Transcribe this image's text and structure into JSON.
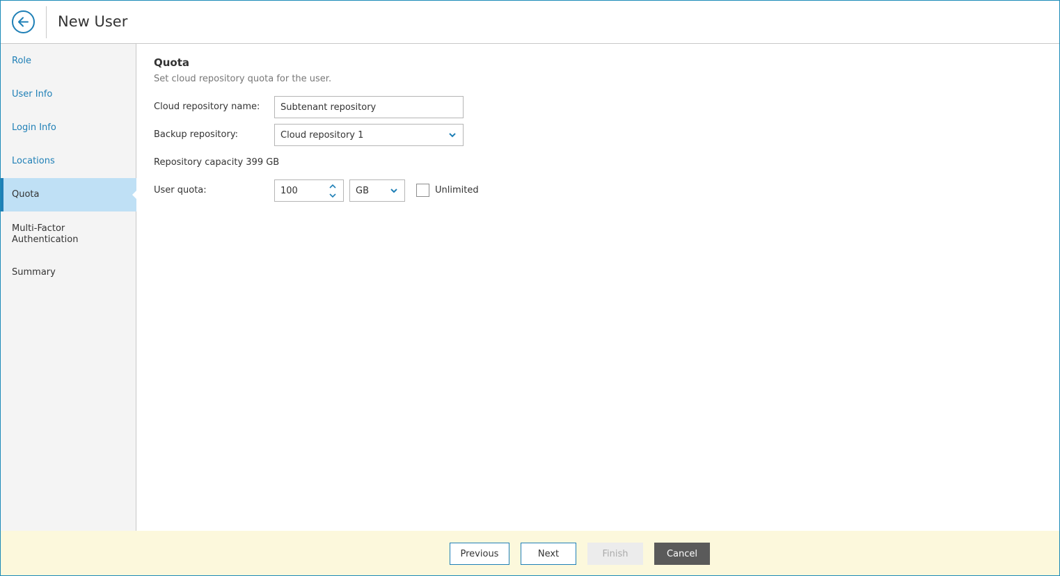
{
  "header": {
    "title": "New User"
  },
  "sidebar": {
    "items": [
      {
        "label": "Role"
      },
      {
        "label": "User Info"
      },
      {
        "label": "Login Info"
      },
      {
        "label": "Locations"
      },
      {
        "label": "Quota"
      },
      {
        "label": "Multi-Factor Authentication"
      },
      {
        "label": "Summary"
      }
    ],
    "active_index": 4
  },
  "main": {
    "title": "Quota",
    "description": "Set cloud repository quota for the user.",
    "cloud_repo_name_label": "Cloud repository name:",
    "cloud_repo_name_value": "Subtenant repository",
    "backup_repo_label": "Backup repository:",
    "backup_repo_value": "Cloud repository 1",
    "capacity_text": "Repository capacity 399 GB",
    "user_quota_label": "User quota:",
    "user_quota_value": "100",
    "quota_unit": "GB",
    "unlimited_label": "Unlimited",
    "unlimited_checked": false
  },
  "footer": {
    "previous_label": "Previous",
    "next_label": "Next",
    "finish_label": "Finish",
    "cancel_label": "Cancel"
  },
  "colors": {
    "accent": "#1e7fb6",
    "active_nav_bg": "#bfe0f5",
    "footer_bg": "#fcf8dc"
  }
}
